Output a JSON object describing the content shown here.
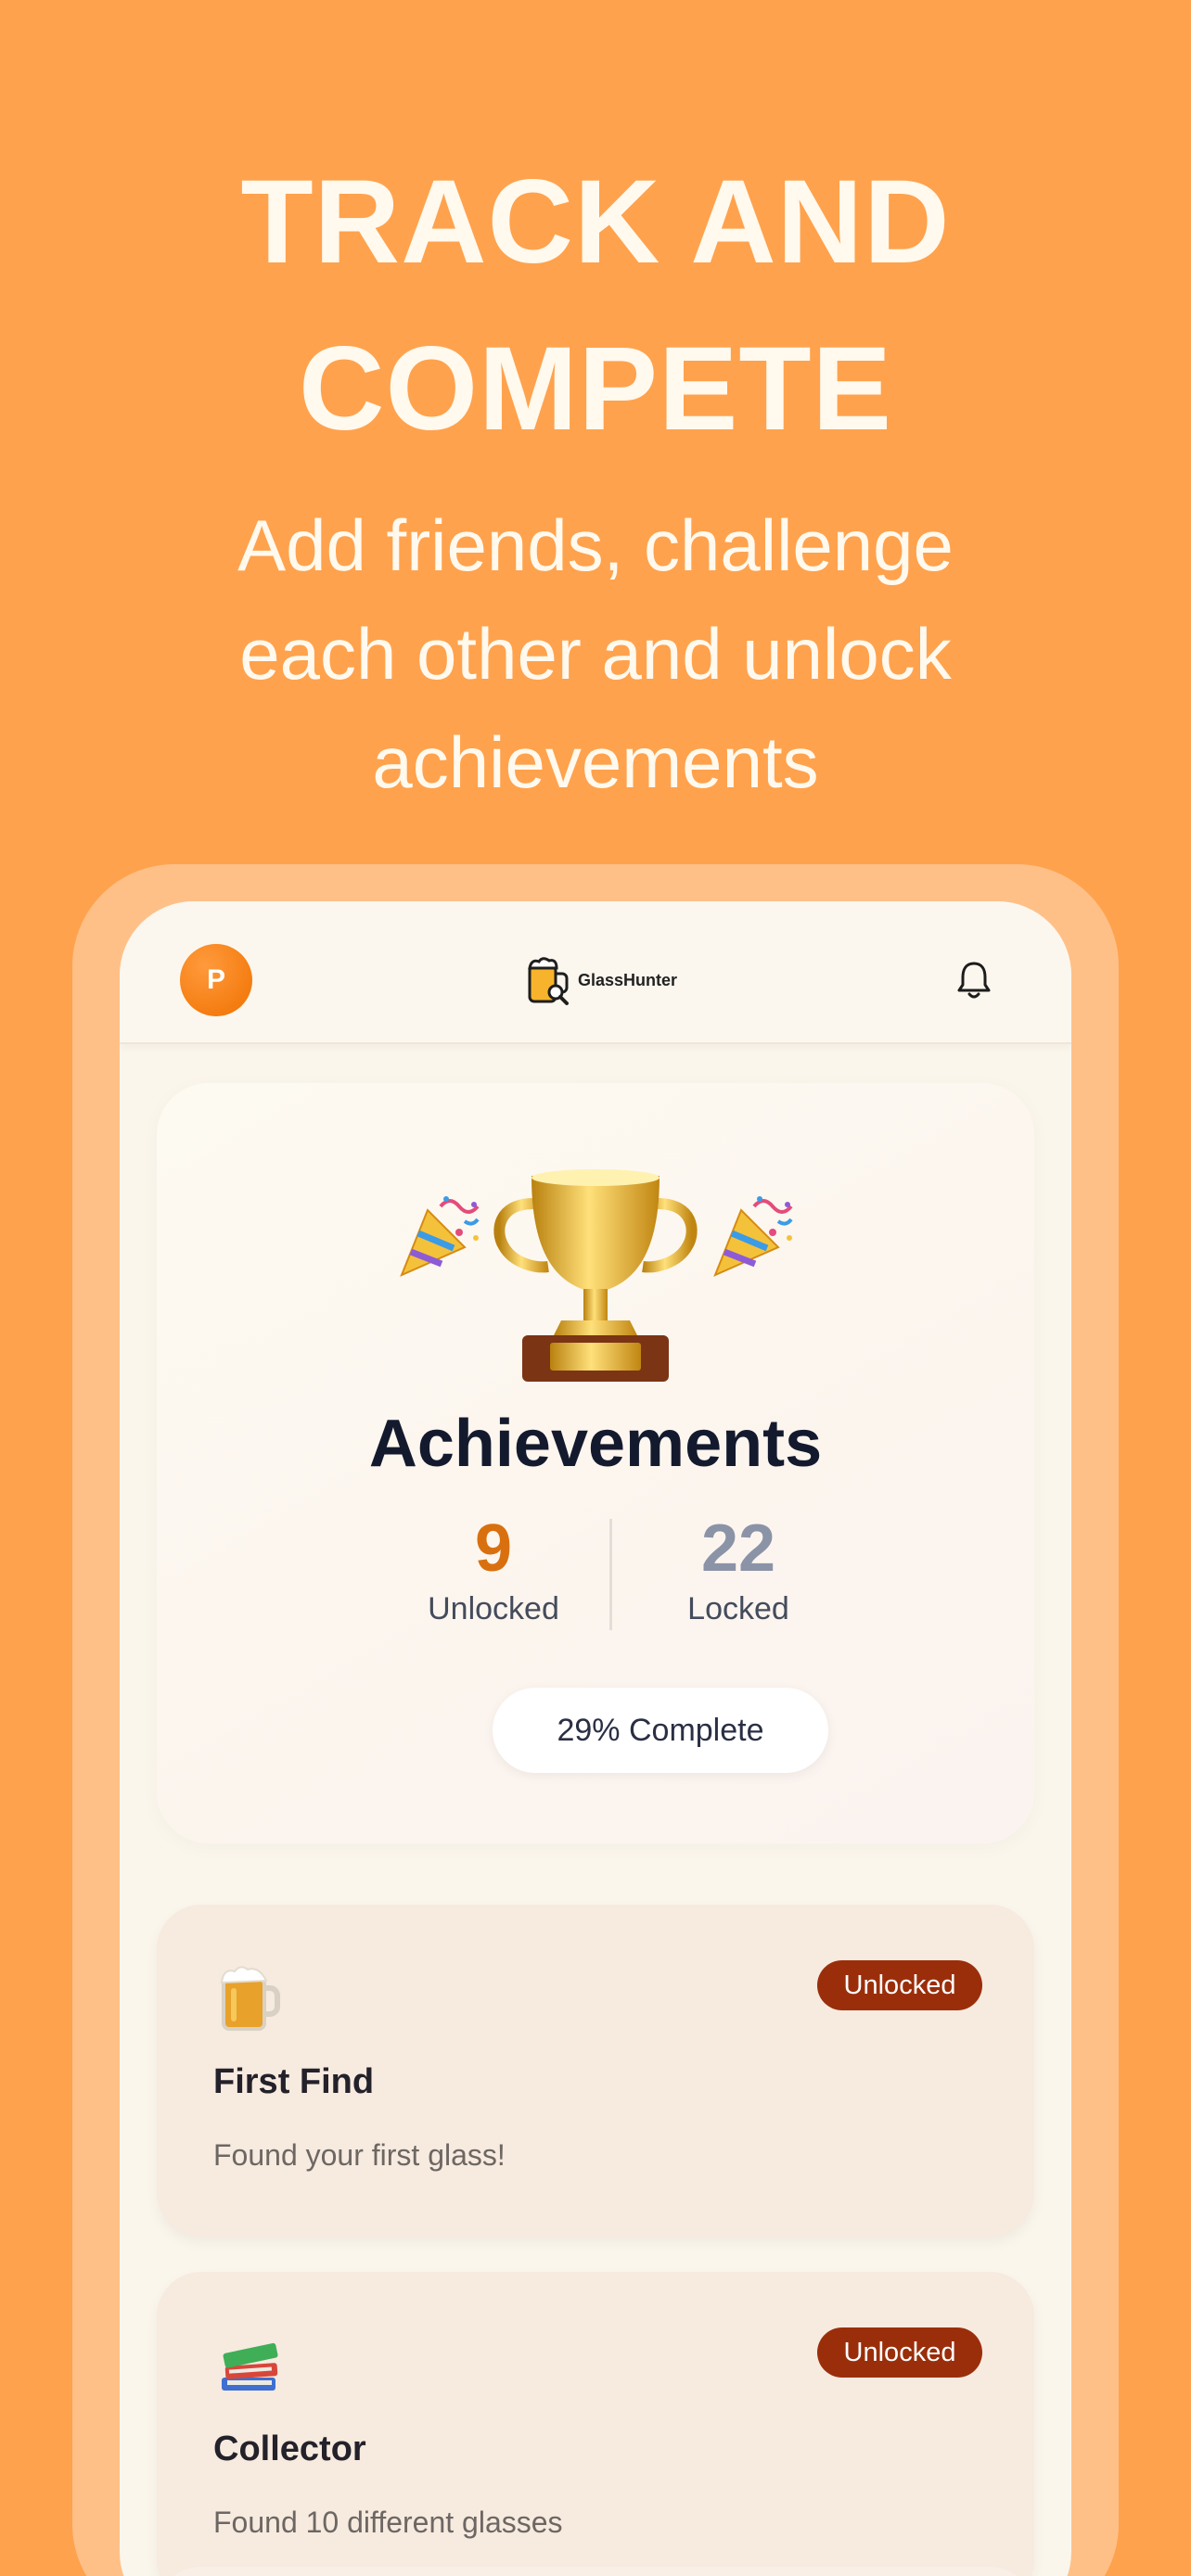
{
  "headline": {
    "line1": "TRACK AND",
    "line2": "COMPETE"
  },
  "subline": {
    "line1": "Add friends, challenge",
    "line2": "each other and unlock",
    "line3": "achievements"
  },
  "topbar": {
    "avatar_initial": "P",
    "logo_text": "GlassHunter",
    "bell_icon": "bell-icon"
  },
  "achievements_summary": {
    "title": "Achievements",
    "unlocked_count": "9",
    "unlocked_label": "Unlocked",
    "locked_count": "22",
    "locked_label": "Locked",
    "progress_text": "29% Complete",
    "icons": [
      "party-popper-icon",
      "trophy-icon",
      "party-popper-icon"
    ]
  },
  "achievements": [
    {
      "icon": "beer-mug-icon",
      "badge": "Unlocked",
      "title": "First Find",
      "description": "Found your first glass!"
    },
    {
      "icon": "books-icon",
      "badge": "Unlocked",
      "title": "Collector",
      "description": "Found 10 different glasses"
    }
  ],
  "colors": {
    "background": "#FFA24D",
    "accent": "#F07100",
    "badge": "#9A2E0B",
    "unlocked_number": "#D9700F",
    "locked_number": "#8B93A7"
  }
}
